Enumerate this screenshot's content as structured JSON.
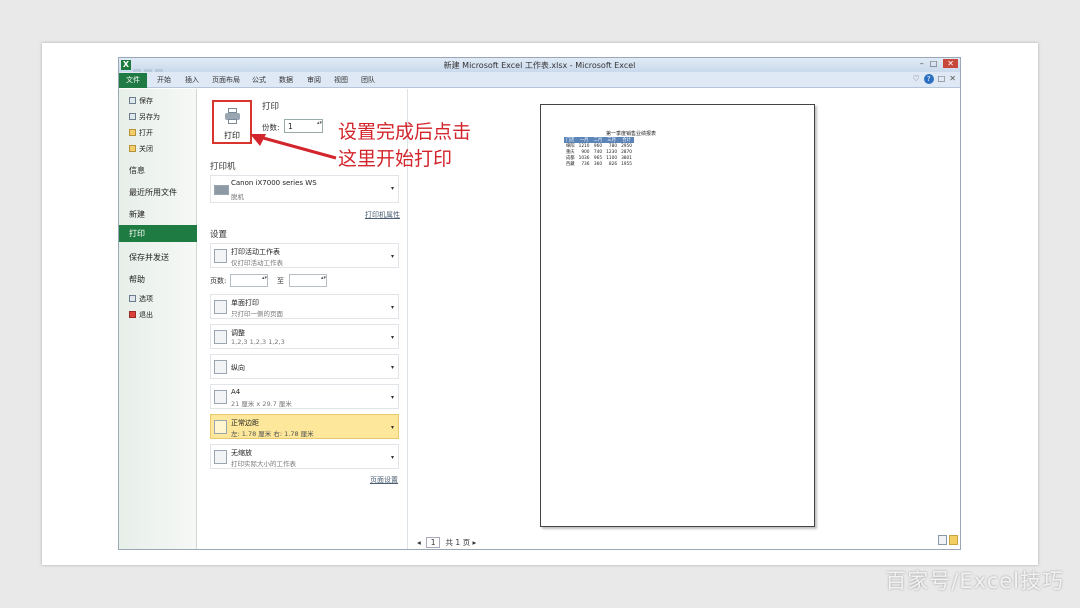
{
  "window": {
    "title": "新建 Microsoft Excel 工作表.xlsx - Microsoft Excel",
    "logo": "X",
    "controls": [
      "–",
      "□",
      "✕"
    ]
  },
  "ribbon": {
    "file_tab": "文件",
    "tabs": [
      "开始",
      "插入",
      "页面布局",
      "公式",
      "数据",
      "审阅",
      "视图",
      "团队"
    ],
    "right_icons": [
      "♡",
      "?",
      "□",
      "✕"
    ]
  },
  "backstage": {
    "items_top": [
      {
        "label": "保存",
        "icon": "save-icon"
      },
      {
        "label": "另存为",
        "icon": "save-as-icon"
      },
      {
        "label": "打开",
        "icon": "open-icon"
      },
      {
        "label": "关闭",
        "icon": "close-file-icon"
      }
    ],
    "info": "信息",
    "recent": "最近所用文件",
    "new": "新建",
    "print": "打印",
    "save_send": "保存并发送",
    "help": "帮助",
    "options": "选项",
    "exit": "退出"
  },
  "print_panel": {
    "section_title": "打印",
    "print_button": "打印",
    "copies_label": "份数:",
    "copies_value": "1",
    "printer_title": "打印机",
    "printer_name": "Canon iX7000 series WS",
    "printer_status": "脱机",
    "printer_props": "打印机属性",
    "settings_title": "设置",
    "what": {
      "l1": "打印活动工作表",
      "l2": "仅打印活动工作表"
    },
    "pages_label": "页数:",
    "pages_to": "至",
    "sides": {
      "l1": "单面打印",
      "l2": "只打印一侧的页面"
    },
    "collate": {
      "l1": "调整",
      "l2": "1,2,3    1,2,3    1,2,3"
    },
    "orientation": {
      "l1": "纵向",
      "l2": ""
    },
    "paper": {
      "l1": "A4",
      "l2": "21 厘米 x 29.7 厘米"
    },
    "margins": {
      "l1": "正常边距",
      "l2": "左: 1.78 厘米    右: 1.78 厘米"
    },
    "scaling": {
      "l1": "无缩放",
      "l2": "打印实际大小的工作表"
    },
    "page_setup": "页面设置"
  },
  "preview": {
    "sheet_title": "第一季度销售业绩报表",
    "headers": [
      "门店",
      "一月",
      "二月",
      "三月",
      "合计"
    ],
    "rows": [
      [
        "绵阳",
        "1210",
        "960",
        "780",
        "2950"
      ],
      [
        "重庆",
        "900",
        "740",
        "1230",
        "2870"
      ],
      [
        "成都",
        "1036",
        "965",
        "1100",
        "3801"
      ],
      [
        "西藏",
        "736",
        "360",
        "826",
        "1955"
      ]
    ],
    "pager_prev": "◂",
    "pager_current": "1",
    "pager_total": "共 1 页",
    "pager_next": "▸"
  },
  "annotation": {
    "text": "设置完成后点击这里开始打印",
    "color": "#d2252c"
  },
  "watermark": "百家号/Excel技巧",
  "colors": {
    "accent_green": "#1e7b41",
    "highlight": "#fde79a",
    "table_header": "#5b84b8",
    "annotation_red": "#d2252c"
  }
}
